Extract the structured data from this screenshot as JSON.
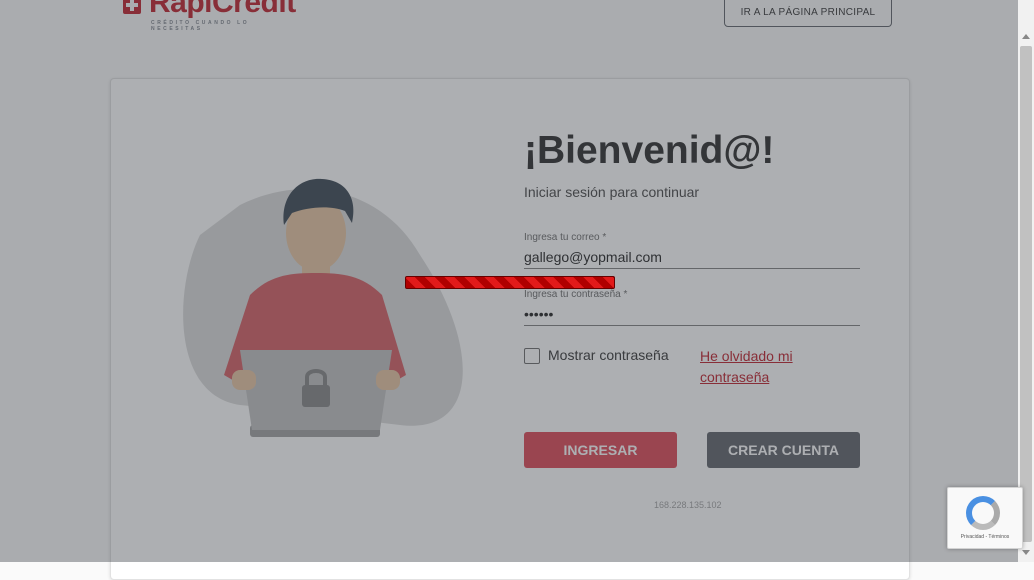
{
  "header": {
    "logo_text": "RapiCredit",
    "logo_tagline": "CRÉDITO CUANDO LO NECESITAS",
    "home_button": "IR A LA PÁGINA PRINCIPAL"
  },
  "login": {
    "title": "¡Bienvenid@!",
    "subtitle": "Iniciar sesión para continuar",
    "email_label": "Ingresa tu correo *",
    "email_value": "gallego@yopmail.com",
    "password_label": "Ingresa tu contraseña *",
    "password_value": "••••••",
    "show_password_label": "Mostrar contraseña",
    "forgot_password": "He olvidado mi contraseña",
    "login_button": "INGRESAR",
    "create_account_button": "CREAR CUENTA",
    "ip_address": "168.228.135.102"
  },
  "recaptcha": {
    "icon": "recaptcha-icon",
    "text": "Privacidad - Términos"
  },
  "colors": {
    "brand": "#c4303a",
    "login_button": "#e05562",
    "secondary_button": "#6b6f75",
    "loader": "#d00000"
  }
}
